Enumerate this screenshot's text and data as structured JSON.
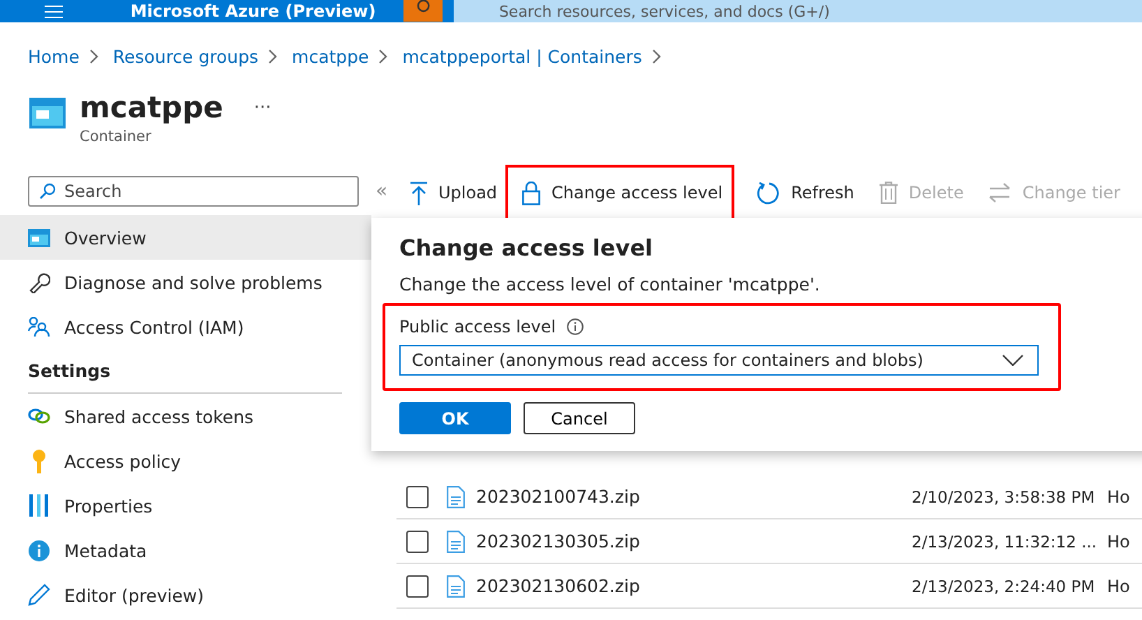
{
  "top_bar": {
    "title": "Microsoft Azure (Preview)",
    "search": {
      "placeholder": "Search resources, services, and docs (G+/)"
    }
  },
  "breadcrumb": [
    "Home",
    "Resource groups",
    "mcatppe",
    "mcatppeportal | Containers"
  ],
  "header": {
    "title": "mcatppe",
    "subtitle": "Container",
    "more": "···"
  },
  "sidebar": {
    "search": {
      "placeholder": "Search"
    },
    "collapse": "«",
    "items": [
      {
        "label": "Overview",
        "selected": true
      },
      {
        "label": "Diagnose and solve problems",
        "selected": false
      },
      {
        "label": "Access Control (IAM)",
        "selected": false
      }
    ],
    "section": "Settings",
    "settings_items": [
      {
        "label": "Shared access tokens",
        "selected": false
      },
      {
        "label": "Access policy",
        "selected": false
      },
      {
        "label": "Properties",
        "selected": false
      },
      {
        "label": "Metadata",
        "selected": false
      },
      {
        "label": "Editor (preview)",
        "selected": false
      }
    ]
  },
  "toolbar": [
    {
      "label": "Upload",
      "disabled": false,
      "highlighted": false
    },
    {
      "label": "Change access level",
      "disabled": false,
      "highlighted": true
    },
    {
      "label": "Refresh",
      "disabled": false,
      "highlighted": false
    },
    {
      "label": "Delete",
      "disabled": true,
      "highlighted": false
    },
    {
      "label": "Change tier",
      "disabled": true,
      "highlighted": false
    }
  ],
  "dialog": {
    "title": "Change access level",
    "description": "Change the access level of container 'mcatppe'.",
    "field_label": "Public access level",
    "dropdown": {
      "value": "Container (anonymous read access for containers and blobs)"
    },
    "highlighted": true,
    "buttons": [
      {
        "label": "OK",
        "primary": true
      },
      {
        "label": "Cancel",
        "primary": false
      }
    ]
  },
  "table": {
    "rows": [
      {
        "name": "202302100743.zip",
        "modified": "2/10/2023, 3:58:38 PM",
        "column_3": "Ho",
        "checked": false
      },
      {
        "name": "202302130305.zip",
        "modified": "2/13/2023, 11:32:12 ...",
        "column_3": "Ho",
        "checked": false
      },
      {
        "name": "202302130602.zip",
        "modified": "2/13/2023, 2:24:40 PM",
        "column_3": "Ho",
        "checked": false
      }
    ]
  }
}
